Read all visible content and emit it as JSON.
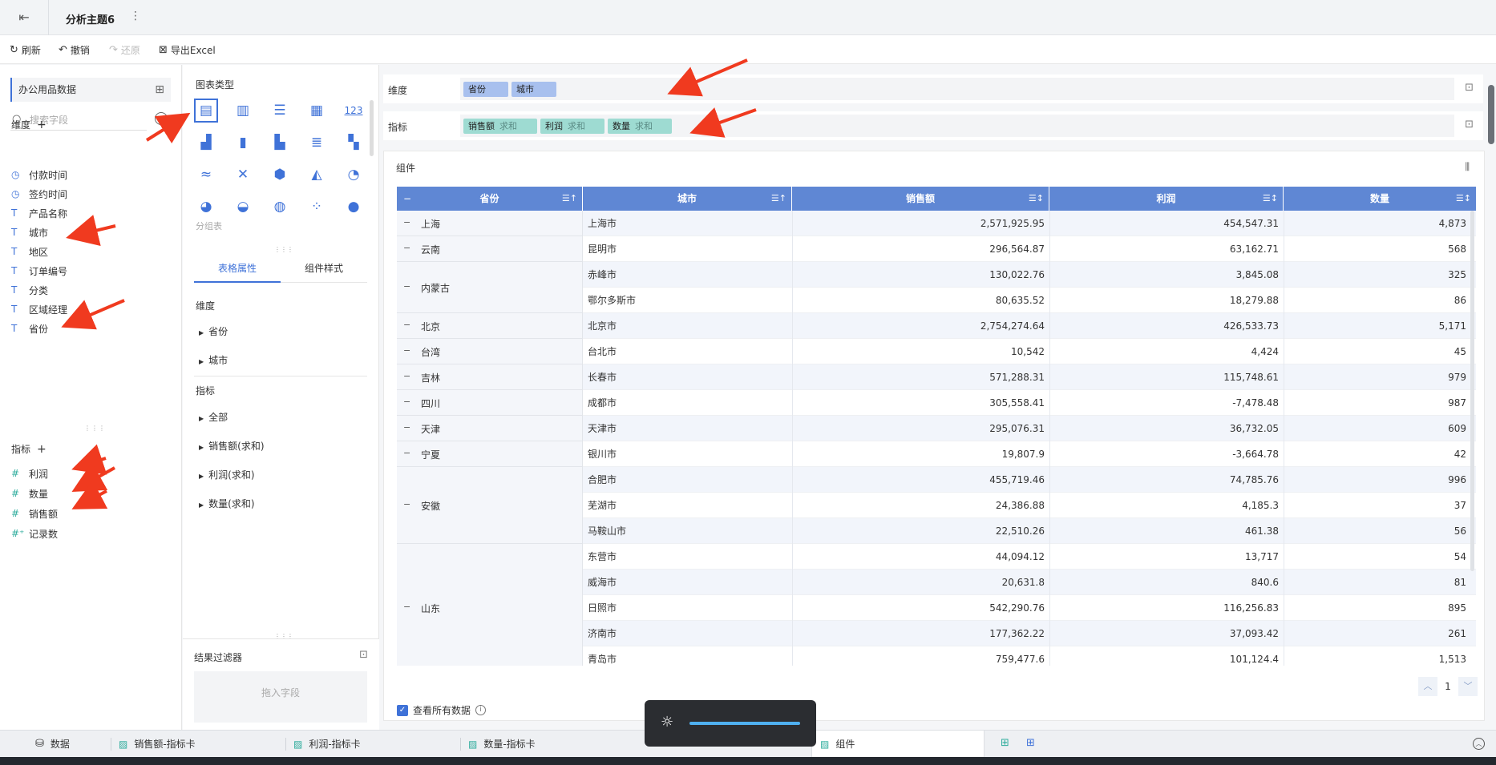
{
  "header": {
    "title": "分析主题6"
  },
  "toolbar": {
    "refresh": "刷新",
    "undo": "撤销",
    "redo": "还原",
    "export": "导出Excel"
  },
  "left": {
    "dataset": "办公用品数据",
    "search_placeholder": "搜索字段",
    "dimensions_title": "维度",
    "dimensions": [
      {
        "type": "time",
        "label": "付款时间"
      },
      {
        "type": "time",
        "label": "签约时间"
      },
      {
        "type": "text",
        "label": "产品名称"
      },
      {
        "type": "text",
        "label": "城市"
      },
      {
        "type": "text",
        "label": "地区"
      },
      {
        "type": "text",
        "label": "订单编号"
      },
      {
        "type": "text",
        "label": "分类"
      },
      {
        "type": "text",
        "label": "区域经理"
      },
      {
        "type": "text",
        "label": "省份"
      }
    ],
    "metrics_title": "指标",
    "metrics": [
      {
        "type": "num",
        "label": "利润"
      },
      {
        "type": "num",
        "label": "数量"
      },
      {
        "type": "num",
        "label": "销售额"
      },
      {
        "type": "calc",
        "label": "记录数"
      }
    ]
  },
  "mid": {
    "chart_type_title": "图表类型",
    "number_chart_label": "123",
    "group_table_label": "分组表",
    "tabs": [
      "表格属性",
      "组件样式"
    ],
    "dim_header": "维度",
    "dim_items": [
      "省份",
      "城市"
    ],
    "metric_header": "指标",
    "metric_items": [
      "全部",
      "销售额(求和)",
      "利润(求和)",
      "数量(求和)"
    ],
    "filter_title": "结果过滤器",
    "filter_drop": "拖入字段"
  },
  "shelves": {
    "dim_label": "维度",
    "dim_pills": [
      "省份",
      "城市"
    ],
    "metric_label": "指标",
    "metric_pills": [
      {
        "name": "销售额",
        "agg": "求和"
      },
      {
        "name": "利润",
        "agg": "求和"
      },
      {
        "name": "数量",
        "agg": "求和"
      }
    ]
  },
  "component": {
    "title": "组件",
    "columns": [
      "省份",
      "城市",
      "销售额",
      "利润",
      "数量"
    ],
    "provinces": [
      {
        "name": "上海",
        "span": 1
      },
      {
        "name": "云南",
        "span": 1
      },
      {
        "name": "内蒙古",
        "span": 2
      },
      {
        "name": "北京",
        "span": 1
      },
      {
        "name": "台湾",
        "span": 1
      },
      {
        "name": "吉林",
        "span": 1
      },
      {
        "name": "四川",
        "span": 1
      },
      {
        "name": "天津",
        "span": 1
      },
      {
        "name": "宁夏",
        "span": 1
      },
      {
        "name": "安徽",
        "span": 3
      },
      {
        "name": "山东",
        "span": 5
      }
    ],
    "rows": [
      [
        "上海市",
        "2,571,925.95",
        "454,547.31",
        "4,873"
      ],
      [
        "昆明市",
        "296,564.87",
        "63,162.71",
        "568"
      ],
      [
        "赤峰市",
        "130,022.76",
        "3,845.08",
        "325"
      ],
      [
        "鄂尔多斯市",
        "80,635.52",
        "18,279.88",
        "86"
      ],
      [
        "北京市",
        "2,754,274.64",
        "426,533.73",
        "5,171"
      ],
      [
        "台北市",
        "10,542",
        "4,424",
        "45"
      ],
      [
        "长春市",
        "571,288.31",
        "115,748.61",
        "979"
      ],
      [
        "成都市",
        "305,558.41",
        "-7,478.48",
        "987"
      ],
      [
        "天津市",
        "295,076.31",
        "36,732.05",
        "609"
      ],
      [
        "银川市",
        "19,807.9",
        "-3,664.78",
        "42"
      ],
      [
        "合肥市",
        "455,719.46",
        "74,785.76",
        "996"
      ],
      [
        "芜湖市",
        "24,386.88",
        "4,185.3",
        "37"
      ],
      [
        "马鞍山市",
        "22,510.26",
        "461.38",
        "56"
      ],
      [
        "东营市",
        "44,094.12",
        "13,717",
        "54"
      ],
      [
        "威海市",
        "20,631.8",
        "840.6",
        "81"
      ],
      [
        "日照市",
        "542,290.76",
        "116,256.83",
        "895"
      ],
      [
        "济南市",
        "177,362.22",
        "37,093.42",
        "261"
      ],
      [
        "青岛市",
        "759,477.6",
        "101,124.4",
        "1,513"
      ]
    ],
    "page": "1",
    "show_all": "查看所有数据"
  },
  "sheets": {
    "data": "数据",
    "tabs": [
      "销售额-指标卡",
      "利润-指标卡",
      "数量-指标卡",
      "组件"
    ]
  },
  "colors": {
    "accent": "#3f72d8",
    "header": "#5f87d4",
    "metric": "#2bab9b",
    "arrow": "#f03a1f"
  }
}
